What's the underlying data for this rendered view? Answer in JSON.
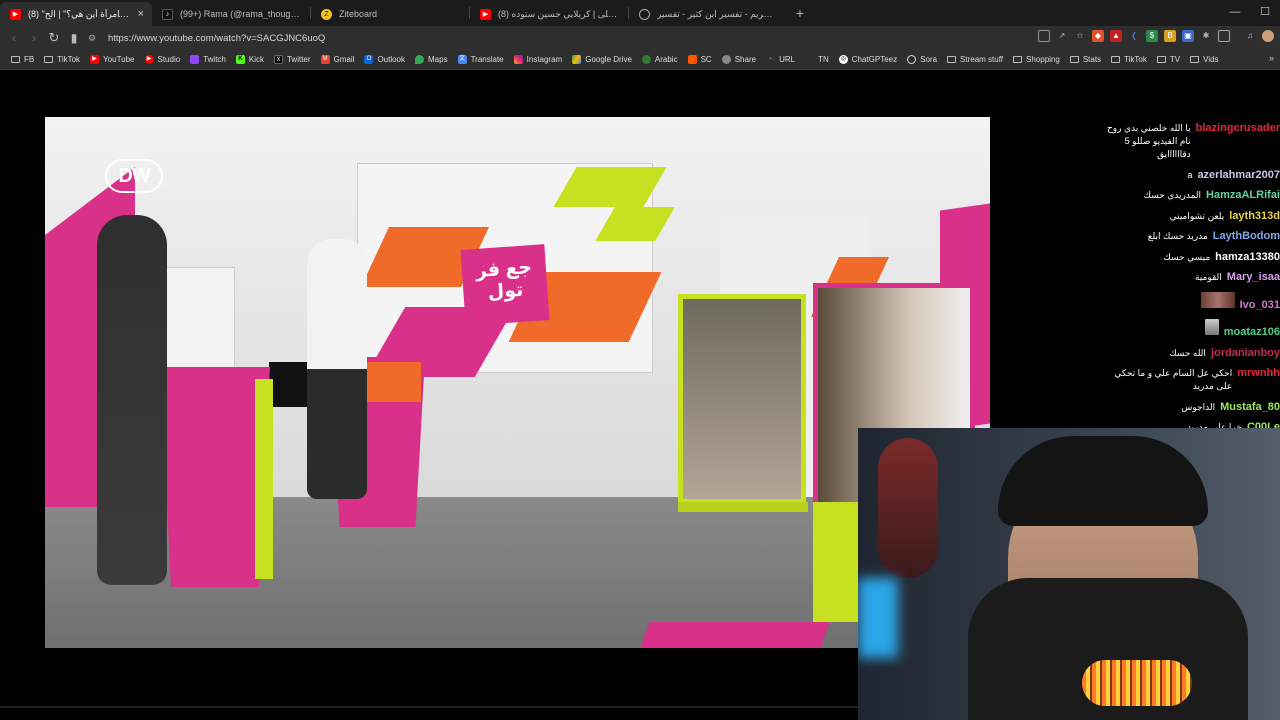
{
  "tabs": [
    {
      "label": "(8) \"حقوقي كامرأة أين هي؟\" | الح...",
      "favicon": "youtube-icon",
      "active": true
    },
    {
      "label": "(99+) Rama (@rama_thoughts) | TikT...",
      "favicon": "tiktok-icon",
      "active": false
    },
    {
      "label": "Ziteboard",
      "favicon": "ziteboard-icon",
      "active": false
    },
    {
      "label": "(8) ثيار على | كربلايي حسين ستوده | ...",
      "favicon": "youtube-icon",
      "active": false
    },
    {
      "label": "القرآن الكريم - تفسير ابن كثير - تفسير ...",
      "favicon": "globe-icon",
      "active": false
    }
  ],
  "tab_close": "×",
  "new_tab": "+",
  "window_controls": {
    "minimize": "—",
    "maximize": "☐",
    "close": "✕"
  },
  "address": {
    "url": "https://www.youtube.com/watch?v=SACGJNC6uoQ"
  },
  "bookmarks": [
    {
      "label": "FB",
      "icon": "folder-icon",
      "color": "#888888"
    },
    {
      "label": "TikTok",
      "icon": "folder-icon",
      "color": "#888888"
    },
    {
      "label": "YouTube",
      "icon": "youtube-icon",
      "color": "#ff0000"
    },
    {
      "label": "Studio",
      "icon": "youtube-studio-icon",
      "color": "#ff0000"
    },
    {
      "label": "Twitch",
      "icon": "twitch-icon",
      "color": "#9146ff"
    },
    {
      "label": "Kick",
      "icon": "kick-icon",
      "color": "#53fc18"
    },
    {
      "label": "Twitter",
      "icon": "x-icon",
      "color": "#000000"
    },
    {
      "label": "Gmail",
      "icon": "gmail-icon",
      "color": "#ea4335"
    },
    {
      "label": "Outlook",
      "icon": "outlook-icon",
      "color": "#0a64d6"
    },
    {
      "label": "Maps",
      "icon": "maps-icon",
      "color": "#34a853"
    },
    {
      "label": "Translate",
      "icon": "translate-icon",
      "color": "#4285f4"
    },
    {
      "label": "Instagram",
      "icon": "instagram-icon",
      "color": "#e1306c"
    },
    {
      "label": "Google Drive",
      "icon": "drive-icon",
      "color": "#fbbc04"
    },
    {
      "label": "Arabic",
      "icon": "arabic-icon",
      "color": "#2e7d32"
    },
    {
      "label": "SC",
      "icon": "sc-icon",
      "color": "#ff5500"
    },
    {
      "label": "Share",
      "icon": "share-icon",
      "color": "#888888"
    },
    {
      "label": "URL",
      "icon": "url-icon",
      "color": "#5fb95f"
    },
    {
      "label": "TN",
      "icon": "tn-icon",
      "color": "#666666"
    },
    {
      "label": "ChatGPTeez",
      "icon": "chatgpt-icon",
      "color": "#ffffff"
    },
    {
      "label": "Sora",
      "icon": "sora-icon",
      "color": "#dddddd"
    },
    {
      "label": "Stream stuff",
      "icon": "folder-icon",
      "color": "#888888"
    },
    {
      "label": "Shopping",
      "icon": "folder-icon",
      "color": "#888888"
    },
    {
      "label": "Stats",
      "icon": "folder-icon",
      "color": "#888888"
    },
    {
      "label": "TikTok",
      "icon": "folder-icon",
      "color": "#888888"
    },
    {
      "label": "TV",
      "icon": "folder-icon",
      "color": "#888888"
    },
    {
      "label": "Vids",
      "icon": "folder-icon",
      "color": "#888888"
    }
  ],
  "bookmarks_more": "»",
  "video": {
    "brand_logo": "DW",
    "show_logo": "جع فر تول"
  },
  "chat": [
    {
      "user": "blazingcrusader",
      "color": "#e0283a",
      "msg": "يا الله خلصني بدي روح نام الفيديو صللو 5 دقاااااايق"
    },
    {
      "user": "azerlahmar2007",
      "color": "#c9c9e8",
      "msg": "a"
    },
    {
      "user": "HamzaALRifai",
      "color": "#63d3a0",
      "msg": "المدريدي حسك"
    },
    {
      "user": "layth313d",
      "color": "#e9d24a",
      "msg": "يلعن تشواميني"
    },
    {
      "user": "LaythBodom",
      "color": "#7fa8e8",
      "msg": "مدريد حسك ابلع"
    },
    {
      "user": "hamza13380",
      "color": "#ffffff",
      "msg": "ميسي حسك"
    },
    {
      "user": "Mary_isaa",
      "color": "#d6a0e8",
      "msg": "القومية"
    },
    {
      "user": "Ivo_031",
      "color": "#d07ac8",
      "msg": ""
    },
    {
      "user": "moataz106",
      "color": "#4fd08a",
      "msg": ""
    },
    {
      "user": "jordanianboy",
      "color": "#c62b52",
      "msg": "الله حسك"
    },
    {
      "user": "mrwnhh",
      "color": "#e0283a",
      "msg": "احكي عل السام علي و ما تحكي على مدريد"
    },
    {
      "user": "Mustafa_80",
      "color": "#9ee85a",
      "msg": "الداجوس"
    },
    {
      "user": "C00Le",
      "color": "#9ee85a",
      "msg": "خرا على مدريد"
    }
  ]
}
